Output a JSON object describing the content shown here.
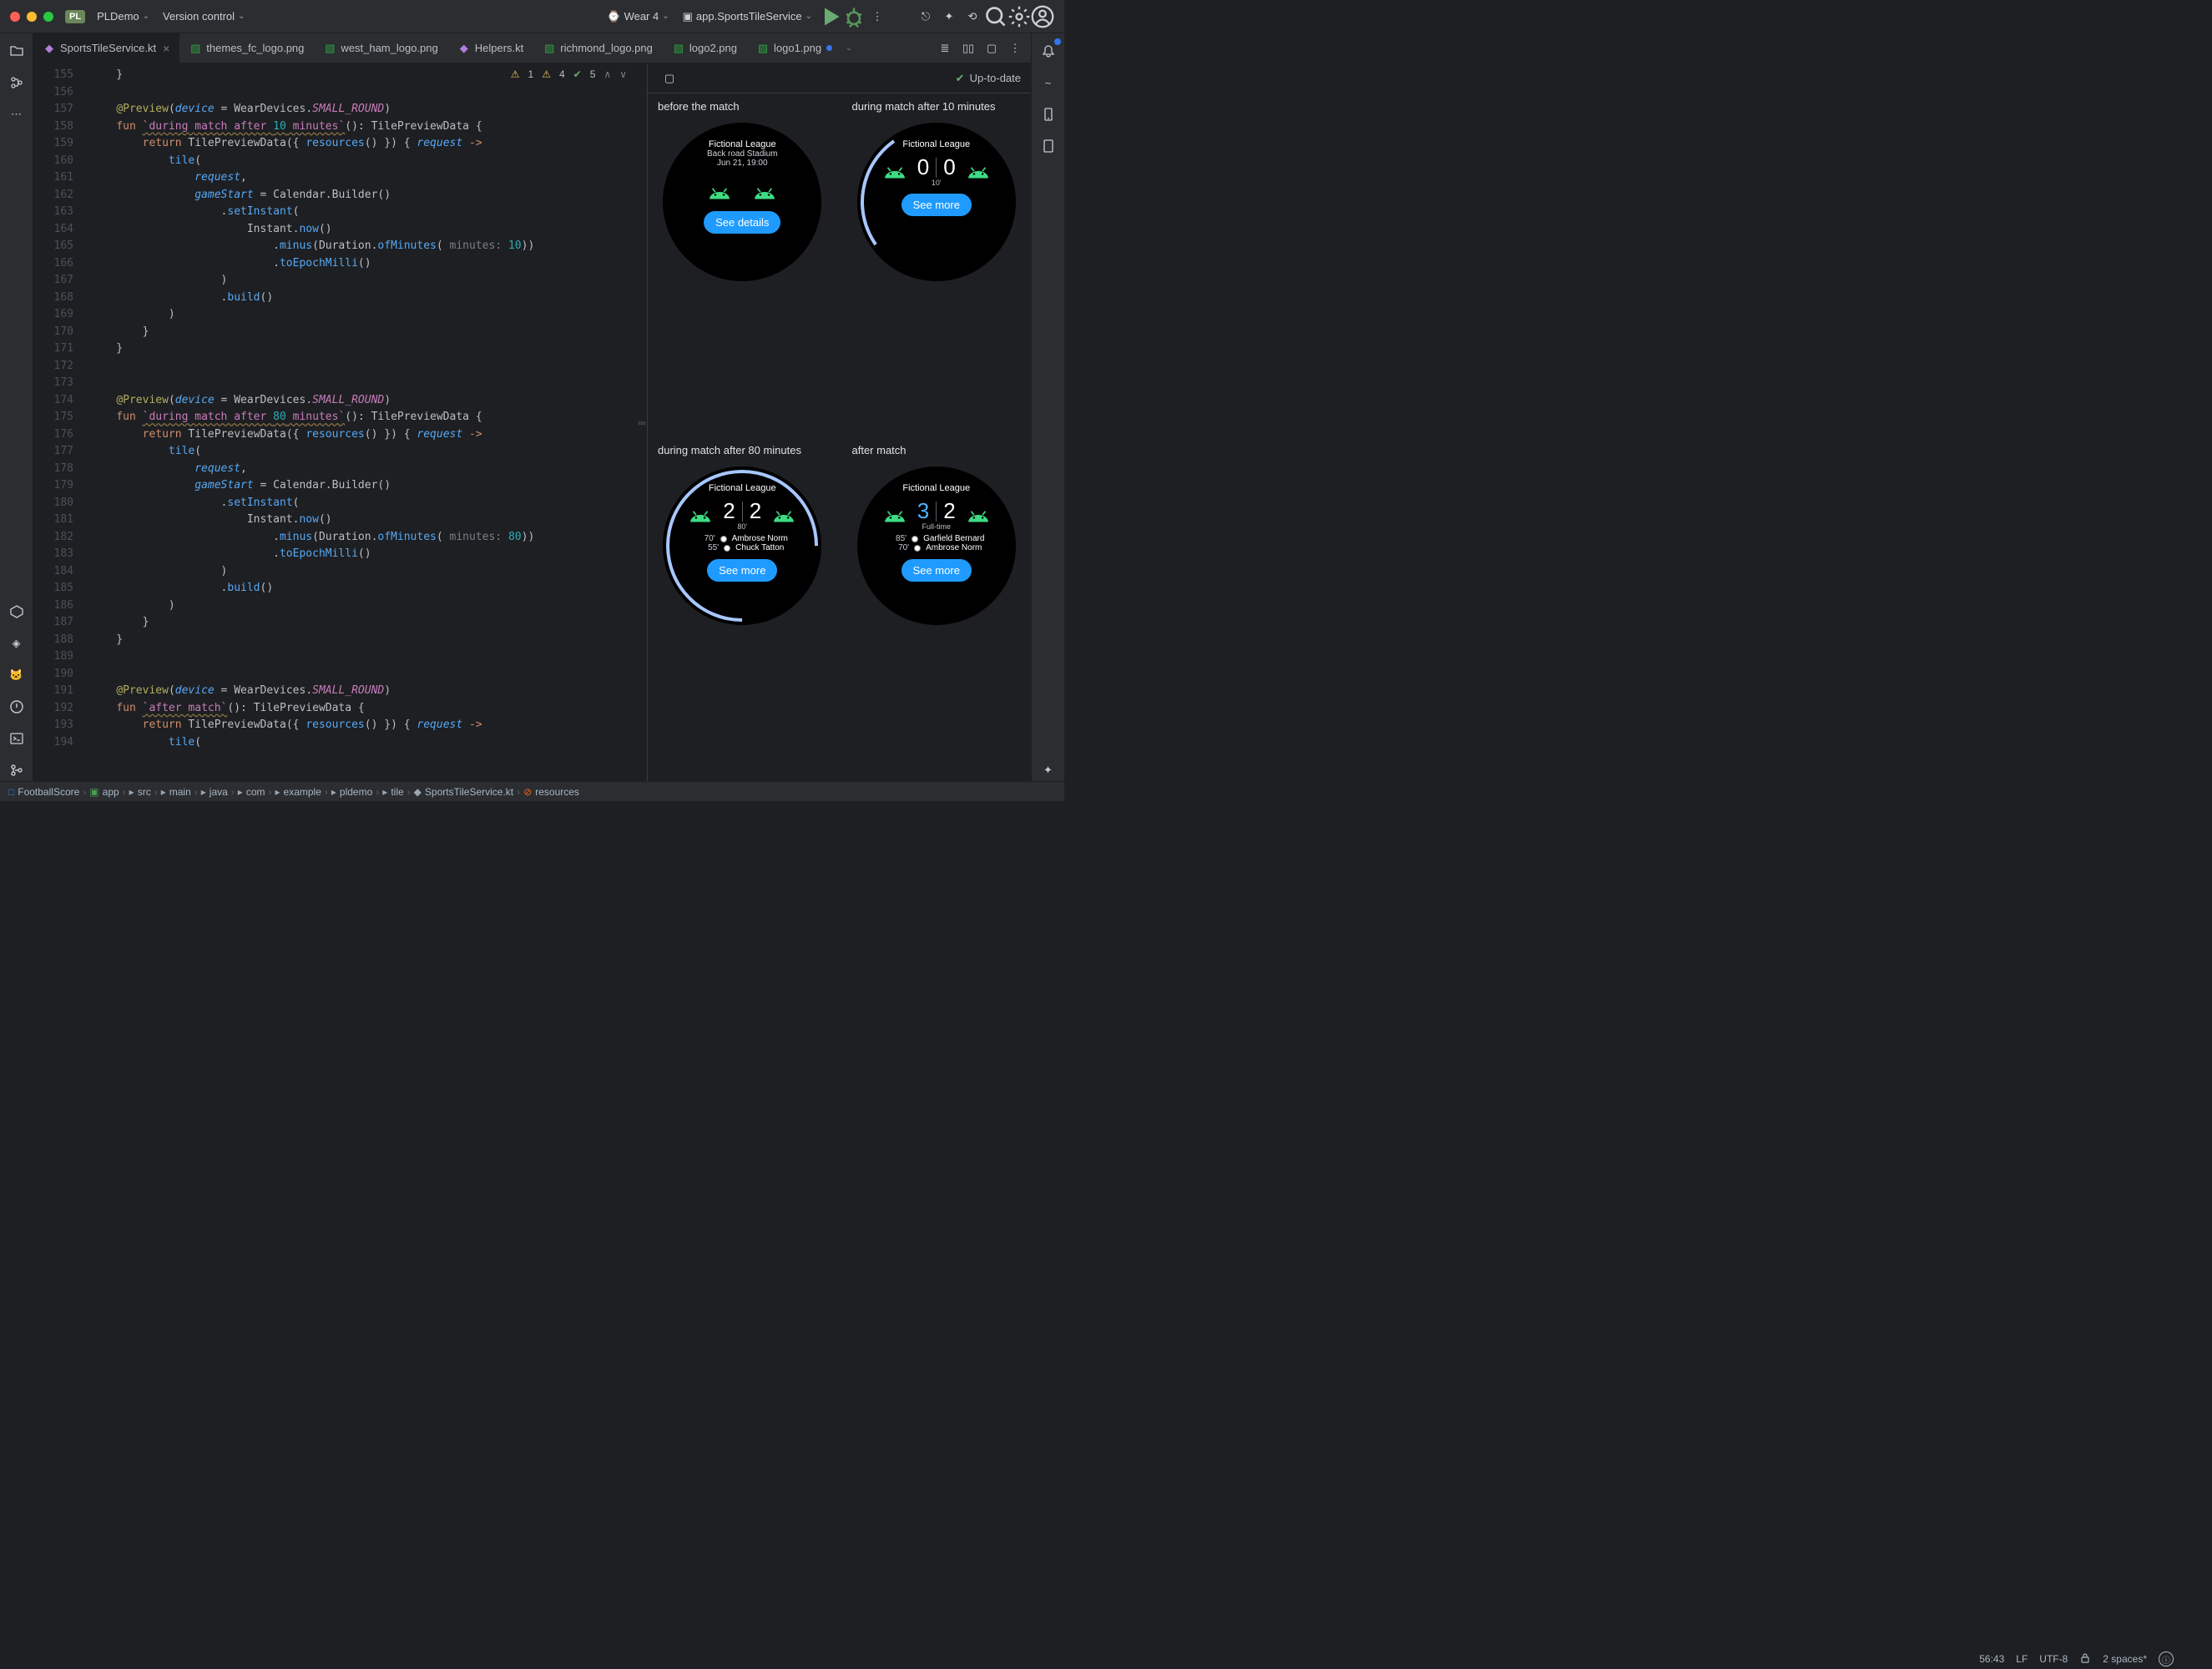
{
  "titlebar": {
    "project_badge": "PL",
    "project_name": "PLDemo",
    "vcs": "Version control",
    "device": "Wear 4",
    "run_config": "app.SportsTileService"
  },
  "tabs": [
    {
      "name": "SportsTileService.kt",
      "icon": "kt",
      "active": true,
      "close": true
    },
    {
      "name": "themes_fc_logo.png",
      "icon": "img",
      "active": false,
      "close": false
    },
    {
      "name": "west_ham_logo.png",
      "icon": "img",
      "active": false,
      "close": false
    },
    {
      "name": "Helpers.kt",
      "icon": "kt",
      "active": false,
      "close": false
    },
    {
      "name": "richmond_logo.png",
      "icon": "img",
      "active": false,
      "close": false
    },
    {
      "name": "logo2.png",
      "icon": "img",
      "active": false,
      "close": false
    },
    {
      "name": "logo1.png",
      "icon": "img",
      "active": false,
      "close": false,
      "dot": true
    }
  ],
  "inspections": {
    "error": "1",
    "warn": "4",
    "weak": "5"
  },
  "line_start": 155,
  "line_end": 194,
  "code_lines": [
    "    }",
    "",
    "    @Preview(device = WearDevices.SMALL_ROUND)",
    "    fun `during match after 10 minutes`(): TilePreviewData {",
    "        return TilePreviewData({ resources() }) { request ->",
    "            tile(",
    "                request,",
    "                gameStart = Calendar.Builder()",
    "                    .setInstant(",
    "                        Instant.now()",
    "                            .minus(Duration.ofMinutes( minutes: 10))",
    "                            .toEpochMilli()",
    "                    )",
    "                    .build()",
    "            )",
    "        }",
    "    }",
    "",
    "",
    "    @Preview(device = WearDevices.SMALL_ROUND)",
    "    fun `during match after 80 minutes`(): TilePreviewData {",
    "        return TilePreviewData({ resources() }) { request ->",
    "            tile(",
    "                request,",
    "                gameStart = Calendar.Builder()",
    "                    .setInstant(",
    "                        Instant.now()",
    "                            .minus(Duration.ofMinutes( minutes: 80))",
    "                            .toEpochMilli()",
    "                    )",
    "                    .build()",
    "            )",
    "        }",
    "    }",
    "",
    "",
    "    @Preview(device = WearDevices.SMALL_ROUND)",
    "    fun `after match`(): TilePreviewData {",
    "        return TilePreviewData({ resources() }) { request ->",
    "            tile("
  ],
  "preview": {
    "status": "Up-to-date",
    "tiles": [
      {
        "title": "before the match",
        "league": "Fictional League",
        "venue": "Back road Stadium",
        "datetime": "Jun 21, 19:00",
        "button": "See details"
      },
      {
        "title": "during match after 10 minutes",
        "league": "Fictional League",
        "score_a": "0",
        "score_b": "0",
        "minute": "10'",
        "button": "See more"
      },
      {
        "title": "during match after 80 minutes",
        "league": "Fictional League",
        "score_a": "2",
        "score_b": "2",
        "minute": "80'",
        "button": "See more",
        "events": [
          {
            "t": "70'",
            "n": "Ambrose Norm"
          },
          {
            "t": "55'",
            "n": "Chuck Tatton"
          }
        ]
      },
      {
        "title": "after match",
        "league": "Fictional League",
        "score_a": "3",
        "score_b": "2",
        "status": "Full-time",
        "button": "See more",
        "events": [
          {
            "t": "85'",
            "n": "Garfield Bernard"
          },
          {
            "t": "70'",
            "n": "Ambrose Norm"
          }
        ]
      }
    ]
  },
  "breadcrumb": [
    "FootballScore",
    "app",
    "src",
    "main",
    "java",
    "com",
    "example",
    "pldemo",
    "tile",
    "SportsTileService.kt",
    "resources"
  ],
  "status": {
    "pos": "56:43",
    "le": "LF",
    "enc": "UTF-8",
    "indent": "2 spaces*"
  }
}
